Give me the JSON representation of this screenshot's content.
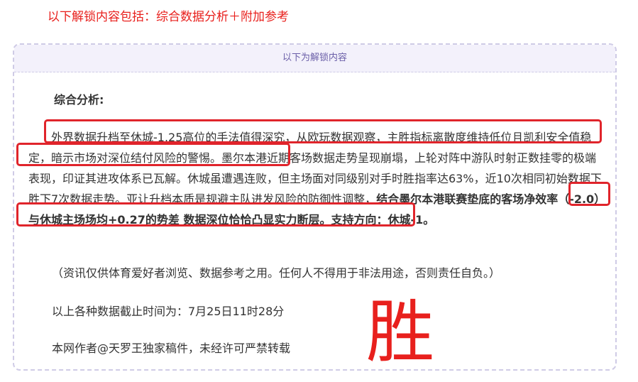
{
  "intro": "以下解锁内容包括：综合数据分析＋附加参考",
  "box": {
    "header": "以下为解锁内容",
    "section_title": "综合分析:",
    "para": {
      "p1": "外界数据升档至休城-1.25高位的手法值得深究，从欧玩数据观察，主胜指标离散度维持低位且凯利安全值稳定，暗示市场对深位结付风险的警惕。墨尔本港近期客场数据走势呈现崩塌，上轮对阵中游队时射正数挂零的极端表现，印证其进攻体系已瓦解。休城虽遭遇连败，但主场面对同级别对手时胜指率达63%，近10次相同初始数据下胜下7次数据走势。亚让升档本质是规避主队进发风险的防御性调整，",
      "p2_bold": "结合墨尔本港联赛垫底的客场净效率（-2.0）与休城主场场均+0.27的势差",
      "p3_bold": " 数据深位恰恰凸显实力断层。支持方向：休城-1。"
    },
    "disclaimer": "（资讯仅供体育爱好者浏览、数据参考之用。任何人不得用于非法用途，否则责任自负。）",
    "cutoff": "以上各种数据截止时间为：7月25日11时28分",
    "copyright": "本网作者@天罗王独家稿件，未经许可严禁转载"
  },
  "stamp_char": "胜",
  "colors": {
    "accent_red": "#e8201d",
    "highlight_border": "#e0242b",
    "box_border": "#cfcbe6",
    "header_bg": "#f3f1fb",
    "header_text": "#6b5fa8"
  }
}
